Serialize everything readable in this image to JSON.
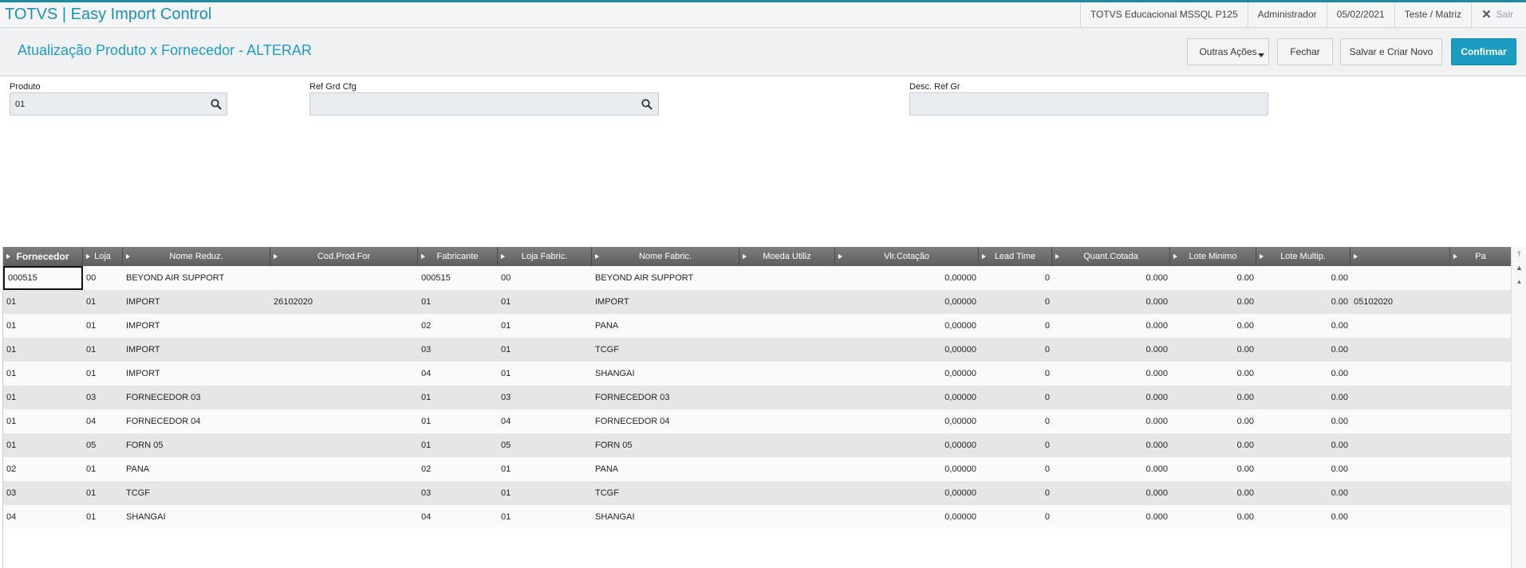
{
  "app": {
    "title": "TOTVS | Easy Import Control",
    "environment": "TOTVS Educacional MSSQL P125",
    "user": "Administrador",
    "date": "05/02/2021",
    "branch": "Teste / Matriz",
    "exit_label": "Sair"
  },
  "page": {
    "title": "Atualização Produto x Fornecedor - ALTERAR"
  },
  "actions": {
    "other_actions": "Outras Ações",
    "close": "Fechar",
    "save_new": "Salvar e Criar Novo",
    "confirm": "Confirmar"
  },
  "form": {
    "produto": {
      "label": "Produto",
      "value": "01"
    },
    "ref_grd_cfg": {
      "label": "Ref Grd Cfg",
      "value": ""
    },
    "desc_ref_gr": {
      "label": "Desc. Ref Gr",
      "value": ""
    }
  },
  "grid": {
    "columns": [
      "Fornecedor",
      "Loja",
      "Nome Reduz.",
      "Cod.Prod.For",
      "Fabricante",
      "Loja Fabric.",
      "Nome Fabric.",
      "Moeda Utiliz",
      "Vlr.Cotação",
      "Lead Time",
      "Quant.Cotada",
      "Lote Minimo",
      "Lote Multip.",
      "",
      "Pa"
    ],
    "rows": [
      [
        "000515",
        "00",
        "BEYOND AIR SUPPORT",
        "",
        "000515",
        "00",
        "BEYOND AIR SUPPORT",
        "",
        "0,00000",
        "0",
        "0.000",
        "0.00",
        "0.00",
        "",
        ""
      ],
      [
        "01",
        "01",
        "IMPORT",
        "26102020",
        "01",
        "01",
        "IMPORT",
        "",
        "0,00000",
        "0",
        "0.000",
        "0.00",
        "0.00",
        "05102020",
        ""
      ],
      [
        "01",
        "01",
        "IMPORT",
        "",
        "02",
        "01",
        "PANA",
        "",
        "0,00000",
        "0",
        "0.000",
        "0.00",
        "0.00",
        "",
        ""
      ],
      [
        "01",
        "01",
        "IMPORT",
        "",
        "03",
        "01",
        "TCGF",
        "",
        "0,00000",
        "0",
        "0.000",
        "0.00",
        "0.00",
        "",
        ""
      ],
      [
        "01",
        "01",
        "IMPORT",
        "",
        "04",
        "01",
        "SHANGAI",
        "",
        "0,00000",
        "0",
        "0.000",
        "0.00",
        "0.00",
        "",
        ""
      ],
      [
        "01",
        "03",
        "FORNECEDOR 03",
        "",
        "01",
        "03",
        "FORNECEDOR 03",
        "",
        "0,00000",
        "0",
        "0.000",
        "0.00",
        "0.00",
        "",
        ""
      ],
      [
        "01",
        "04",
        "FORNECEDOR 04",
        "",
        "01",
        "04",
        "FORNECEDOR 04",
        "",
        "0,00000",
        "0",
        "0.000",
        "0.00",
        "0.00",
        "",
        ""
      ],
      [
        "01",
        "05",
        "FORN 05",
        "",
        "01",
        "05",
        "FORN 05",
        "",
        "0,00000",
        "0",
        "0.000",
        "0.00",
        "0.00",
        "",
        ""
      ],
      [
        "02",
        "01",
        "PANA",
        "",
        "02",
        "01",
        "PANA",
        "",
        "0,00000",
        "0",
        "0.000",
        "0.00",
        "0.00",
        "",
        ""
      ],
      [
        "03",
        "01",
        "TCGF",
        "",
        "03",
        "01",
        "TCGF",
        "",
        "0,00000",
        "0",
        "0.000",
        "0.00",
        "0.00",
        "",
        ""
      ],
      [
        "04",
        "01",
        "SHANGAI",
        "",
        "04",
        "01",
        "SHANGAI",
        "",
        "0,00000",
        "0",
        "0.000",
        "0.00",
        "0.00",
        "",
        ""
      ]
    ]
  },
  "colors": {
    "accent": "#1d9cc1",
    "header_band": "#666666"
  }
}
